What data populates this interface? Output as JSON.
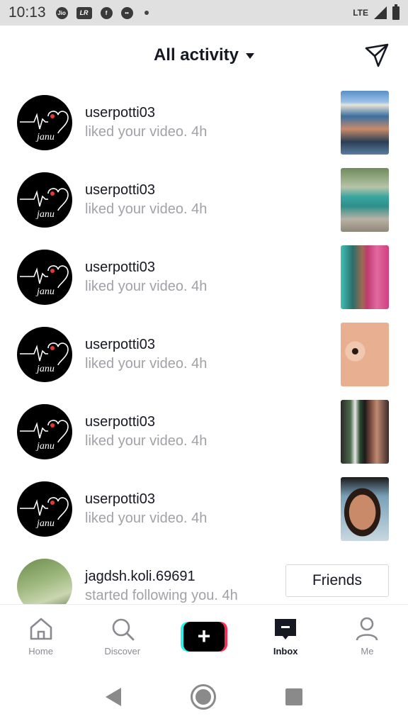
{
  "status_bar": {
    "time": "10:13",
    "icons": [
      "jio-icon",
      "lr-icon",
      "facebook-icon",
      "alien-icon"
    ],
    "lr_label": "LR",
    "network": "LTE"
  },
  "header": {
    "title": "All activity"
  },
  "activities": [
    {
      "username": "userpotti03",
      "action": "liked your video.",
      "time": "4h"
    },
    {
      "username": "userpotti03",
      "action": "liked your video.",
      "time": "4h"
    },
    {
      "username": "userpotti03",
      "action": "liked your video.",
      "time": "4h"
    },
    {
      "username": "userpotti03",
      "action": "liked your video.",
      "time": "4h"
    },
    {
      "username": "userpotti03",
      "action": "liked your video.",
      "time": "4h"
    },
    {
      "username": "userpotti03",
      "action": "liked your video.",
      "time": "4h"
    },
    {
      "username": "jagdsh.koli.69691",
      "action": "started following you.",
      "time": "4h",
      "button": "Friends"
    }
  ],
  "avatar_text": "janu",
  "bottom_nav": {
    "home": "Home",
    "discover": "Discover",
    "inbox": "Inbox",
    "me": "Me"
  },
  "colors": {
    "primary_text": "#161823",
    "secondary_text": "#a1a2a7",
    "brand_cyan": "#25f4ee",
    "brand_pink": "#fe2c55"
  }
}
